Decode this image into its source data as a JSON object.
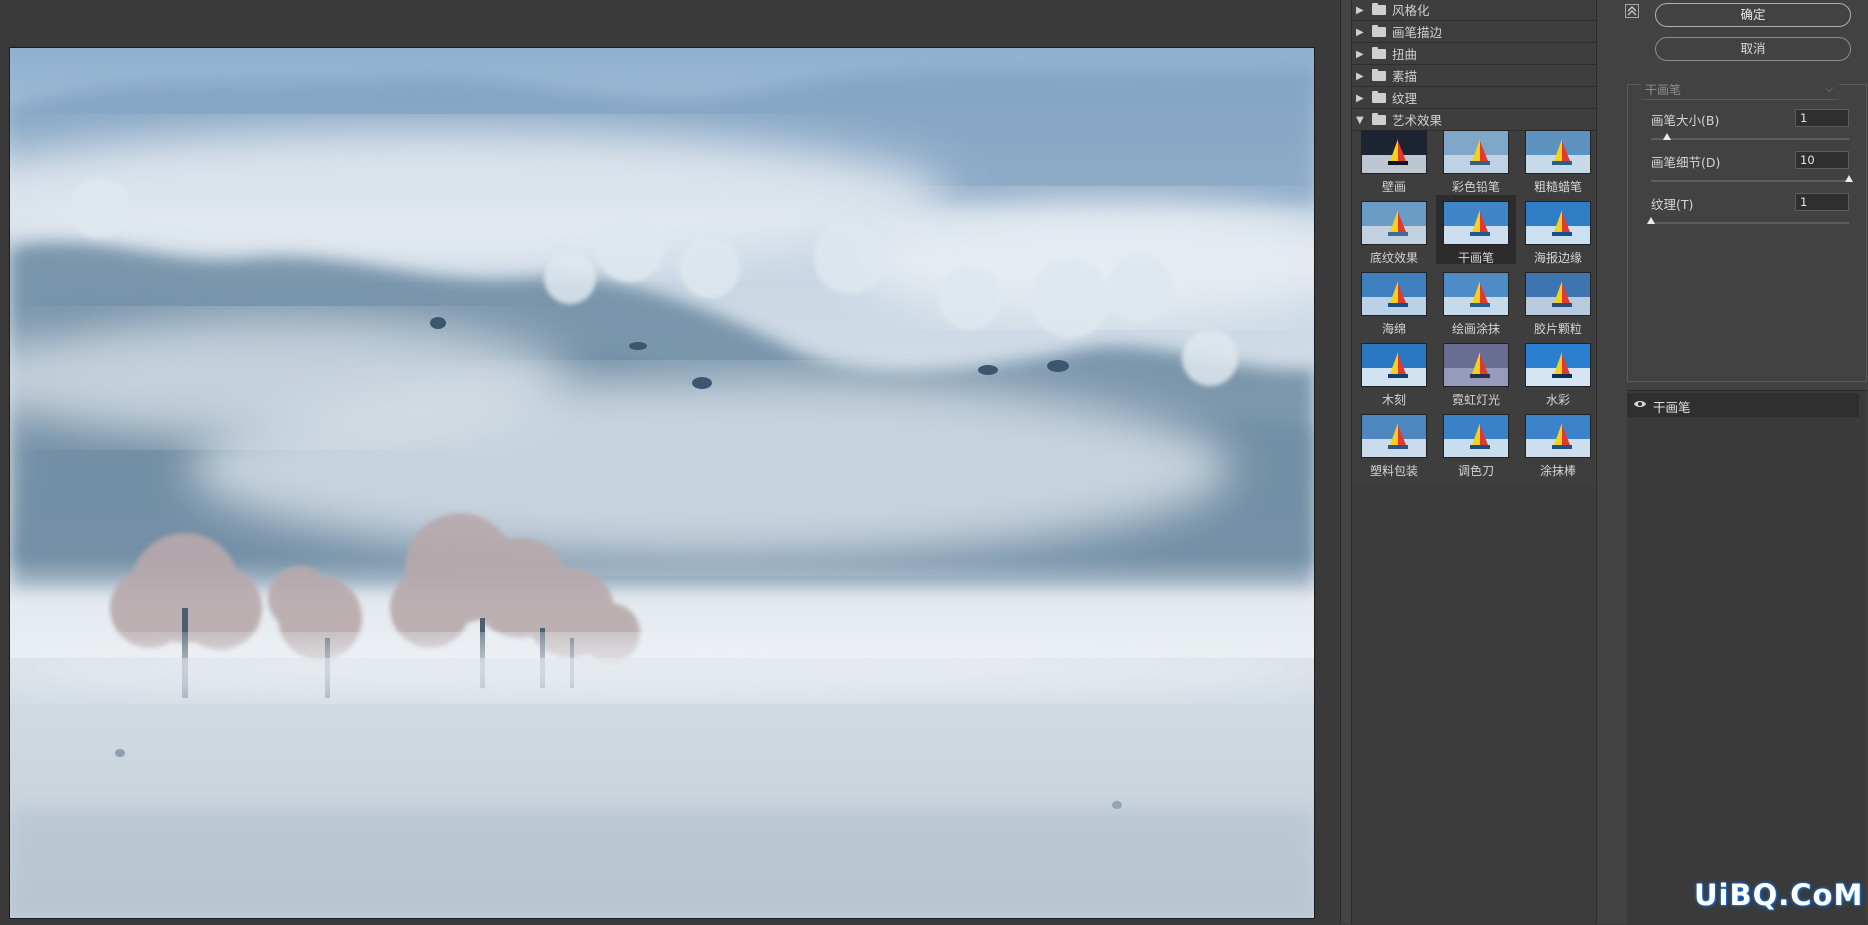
{
  "gallery": {
    "categories": [
      {
        "label": "风格化",
        "expanded": false
      },
      {
        "label": "画笔描边",
        "expanded": false
      },
      {
        "label": "扭曲",
        "expanded": false
      },
      {
        "label": "素描",
        "expanded": false
      },
      {
        "label": "纹理",
        "expanded": false
      },
      {
        "label": "艺术效果",
        "expanded": true
      }
    ],
    "filters": [
      {
        "label": "壁画",
        "selected": false
      },
      {
        "label": "彩色铅笔",
        "selected": false
      },
      {
        "label": "粗糙蜡笔",
        "selected": false
      },
      {
        "label": "底纹效果",
        "selected": false
      },
      {
        "label": "干画笔",
        "selected": true
      },
      {
        "label": "海报边缘",
        "selected": false
      },
      {
        "label": "海绵",
        "selected": false
      },
      {
        "label": "绘画涂抹",
        "selected": false
      },
      {
        "label": "胶片颗粒",
        "selected": false
      },
      {
        "label": "木刻",
        "selected": false
      },
      {
        "label": "霓虹灯光",
        "selected": false
      },
      {
        "label": "水彩",
        "selected": false
      },
      {
        "label": "塑料包装",
        "selected": false
      },
      {
        "label": "调色刀",
        "selected": false
      },
      {
        "label": "涂抹棒",
        "selected": false
      }
    ]
  },
  "settings": {
    "ok_label": "确定",
    "cancel_label": "取消",
    "filter_select_value": "干画笔",
    "params": [
      {
        "label": "画笔大小(B)",
        "value": "1",
        "fraction": 0.08
      },
      {
        "label": "画笔细节(D)",
        "value": "10",
        "fraction": 1.0
      },
      {
        "label": "纹理(T)",
        "value": "1",
        "fraction": 0.0
      }
    ]
  },
  "layers": {
    "active_layer": "干画笔"
  },
  "watermark": "UiBQ.CoM",
  "icons": {
    "collapse": "collapse-up-icon",
    "eye": "eye-icon",
    "folder": "folder-icon",
    "expand": "triangle-right-icon",
    "expanded": "triangle-down-icon",
    "dropdown": "chevron-down-icon"
  },
  "colors": {
    "panel_bg": "#3e3e3e",
    "selected_bg": "#2c2c2c",
    "watermark_glow": "#1a6fd0"
  }
}
